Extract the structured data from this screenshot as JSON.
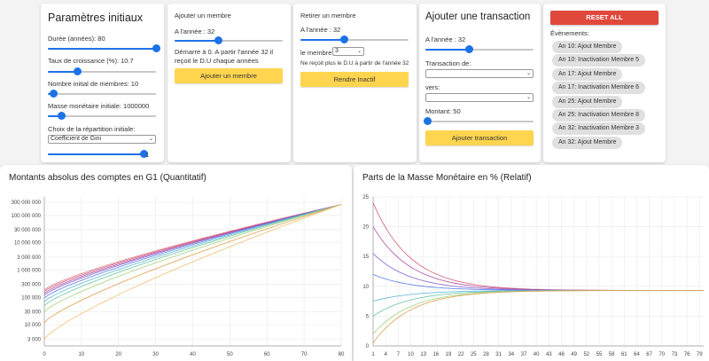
{
  "params": {
    "title": "Paramètres initiaux",
    "duration_label": "Durée (années): 80",
    "growth_label": "Taux de croissance (%): 10.7",
    "members_label": "Nombre initial de membres: 10",
    "mass_label": "Masse monétaire initiale: 1000000",
    "repartition_label": "Choix de la répartition initiale:",
    "repartition_value": "Coefficient de Gini",
    "gini_value": "1"
  },
  "add_member": {
    "title": "Ajouter un membre",
    "year_label": "A l'année : 32",
    "note": "Démarre à 0. A partir l'année 32 il reçoit le D.U chaque années",
    "button": "Ajouter un membre"
  },
  "remove_member": {
    "title": "Retirer un membre",
    "year_label": "A l'année : 32",
    "member_label": "le membre:",
    "member_value": "3",
    "note": "Ne reçoit plus le D.U à partir de l'année 32",
    "button": "Rendre Inactif"
  },
  "transaction": {
    "title": "Ajouter une transaction",
    "year_label": "A l'année : 32",
    "from_label": "Transaction de:",
    "to_label": "vers:",
    "amount_label": "Montant: 50",
    "button": "Ajouter transaction"
  },
  "events": {
    "reset_button": "RESET ALL",
    "title": "Évènements:",
    "items": [
      "An 10: Ajout Membre",
      "An 10: Inactivation Membre 5",
      "An 17: Ajout Membre",
      "An 17: Inactivation Membre 6",
      "An 25: Ajout Membre",
      "An 25: Inactivation Membre 8",
      "An 32: Inactivation Membre 3",
      "An 32: Ajout Membre"
    ]
  },
  "colors": {
    "accent": "#1d72e8",
    "button_yellow": "#ffd54f",
    "reset_red": "#e0483c"
  },
  "chart_data": [
    {
      "type": "line",
      "title": "Montants absolus des comptes en G1 (Quantitatif)",
      "y_scale": "log",
      "y_tick_labels": [
        "3 000",
        "10 000",
        "30 000",
        "100 000",
        "300 000",
        "1 000 000",
        "3 000 000",
        "10 000 000",
        "30 000 000",
        "100 000 000",
        "300 000 000"
      ],
      "y_ticks": [
        3000,
        10000,
        30000,
        100000,
        300000,
        1000000,
        3000000,
        10000000,
        30000000,
        100000000,
        300000000
      ],
      "x_ticks": [
        0,
        10,
        20,
        30,
        40,
        50,
        60,
        70,
        80
      ],
      "xlim": [
        0,
        80
      ],
      "grid": true,
      "series": [
        {
          "color": "#e07b91",
          "x": [
            0,
            80
          ],
          "y": [
            190000,
            250000000
          ]
        },
        {
          "color": "#d35c7a",
          "x": [
            0,
            80
          ],
          "y": [
            165000,
            250000000
          ]
        },
        {
          "color": "#b04fa0",
          "x": [
            0,
            80
          ],
          "y": [
            140000,
            250000000
          ]
        },
        {
          "color": "#8a63d2",
          "x": [
            0,
            80
          ],
          "y": [
            120000,
            250000000
          ]
        },
        {
          "color": "#5b7fe0",
          "x": [
            0,
            80
          ],
          "y": [
            95000,
            250000000
          ]
        },
        {
          "color": "#5fb8d8",
          "x": [
            0,
            80
          ],
          "y": [
            70000,
            250000000
          ]
        },
        {
          "color": "#67c6a0",
          "x": [
            0,
            80
          ],
          "y": [
            50000,
            250000000
          ]
        },
        {
          "color": "#a4d37a",
          "x": [
            0,
            80
          ],
          "y": [
            30000,
            250000000
          ]
        },
        {
          "color": "#e0a050",
          "x": [
            0,
            80
          ],
          "y": [
            12000,
            250000000
          ]
        },
        {
          "color": "#f0c070",
          "x": [
            0,
            80
          ],
          "y": [
            3000,
            250000000
          ]
        }
      ]
    },
    {
      "type": "line",
      "title": "Parts de la Masse Monétaire en % (Relatif)",
      "y_ticks": [
        0,
        5,
        10,
        15,
        20,
        25
      ],
      "ylim": [
        0,
        25
      ],
      "x_tick_labels": [
        "1",
        "4",
        "7",
        "10",
        "13",
        "16",
        "19",
        "22",
        "25",
        "28",
        "31",
        "34",
        "37",
        "40",
        "43",
        "46",
        "49",
        "52",
        "55",
        "58",
        "61",
        "64",
        "67",
        "70",
        "73",
        "76",
        "79"
      ],
      "grid": true,
      "series": [
        {
          "color": "#d35c7a",
          "x": [
            1,
            80
          ],
          "y": [
            24,
            9.3
          ]
        },
        {
          "color": "#b04fa0",
          "x": [
            1,
            80
          ],
          "y": [
            20,
            9.3
          ]
        },
        {
          "color": "#8a63d2",
          "x": [
            1,
            80
          ],
          "y": [
            15.5,
            9.3
          ]
        },
        {
          "color": "#5b7fe0",
          "x": [
            1,
            80
          ],
          "y": [
            12,
            9.3
          ]
        },
        {
          "color": "#5fb8d8",
          "x": [
            1,
            80
          ],
          "y": [
            7.5,
            9.3
          ]
        },
        {
          "color": "#67c6a0",
          "x": [
            1,
            80
          ],
          "y": [
            5,
            9.3
          ]
        },
        {
          "color": "#a4d37a",
          "x": [
            1,
            80
          ],
          "y": [
            2,
            9.3
          ]
        },
        {
          "color": "#e0a050",
          "x": [
            1,
            80
          ],
          "y": [
            0.5,
            9.3
          ]
        }
      ]
    }
  ]
}
